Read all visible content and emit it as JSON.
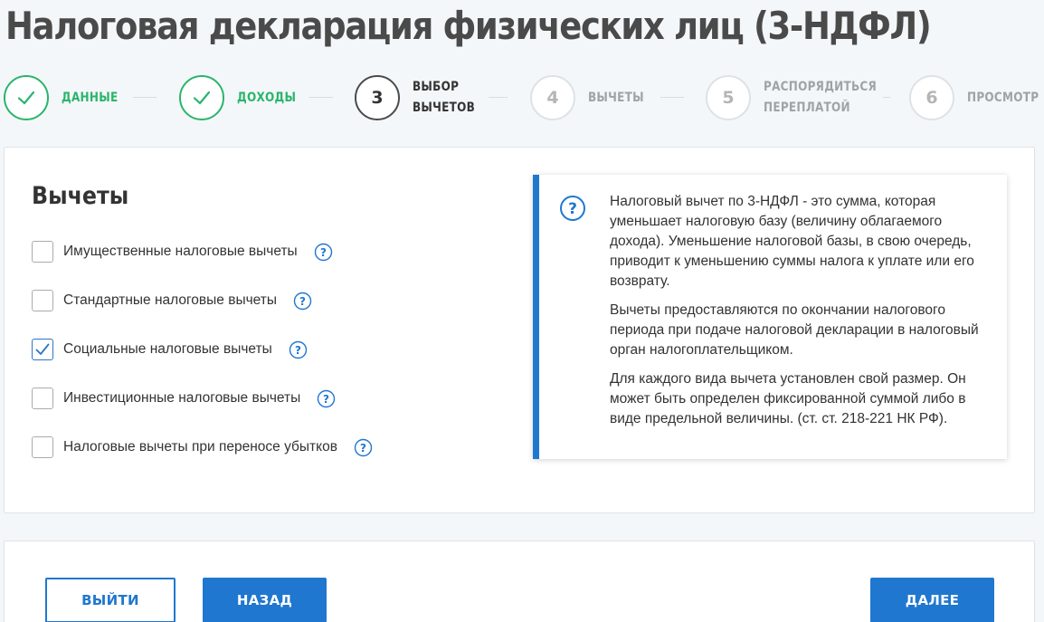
{
  "page": {
    "title": "Налоговая декларация физических лиц (3-НДФЛ)"
  },
  "stepper": {
    "steps": [
      {
        "number": "1",
        "label": "Данные",
        "state": "done"
      },
      {
        "number": "2",
        "label": "Доходы",
        "state": "done"
      },
      {
        "number": "3",
        "label": "Выбор\nвычетов",
        "state": "current"
      },
      {
        "number": "4",
        "label": "Вычеты",
        "state": "future"
      },
      {
        "number": "5",
        "label": "Распорядиться\nпереплатой",
        "state": "future"
      },
      {
        "number": "6",
        "label": "Просмотр",
        "state": "future"
      }
    ]
  },
  "deductions": {
    "title": "Вычеты",
    "options": [
      {
        "label": "Имущественные налоговые вычеты",
        "checked": false
      },
      {
        "label": "Стандартные налоговые вычеты",
        "checked": false
      },
      {
        "label": "Социальные налоговые вычеты",
        "checked": true
      },
      {
        "label": "Инвестиционные налоговые вычеты",
        "checked": false
      },
      {
        "label": "Налоговые вычеты при переносе убытков",
        "checked": false
      }
    ]
  },
  "info": {
    "paragraphs": [
      "Налоговый вычет по 3-НДФЛ - это сумма, которая уменьшает налоговую базу (величину облагаемого дохода). Уменьшение налоговой базы, в свою очередь, приводит к уменьшению суммы налога к уплате или его возврату.",
      "Вычеты предоставляются по окончании налогового периода при подаче налоговой декларации в налоговый орган налогоплательщиком.",
      "Для каждого вида вычета установлен свой размер. Он может быть определен фиксированной суммой либо в виде предельной величины. (ст. ст. 218-221 НК РФ)."
    ]
  },
  "actions": {
    "exit_label": "ВЫЙТИ",
    "back_label": "НАЗАД",
    "next_label": "ДАЛЕЕ"
  },
  "colors": {
    "accent": "#1f77d0",
    "success": "#29b56b",
    "muted": "#9ea3a8"
  },
  "icons": {
    "done_step": "check-icon",
    "help": "question-circle-icon"
  }
}
